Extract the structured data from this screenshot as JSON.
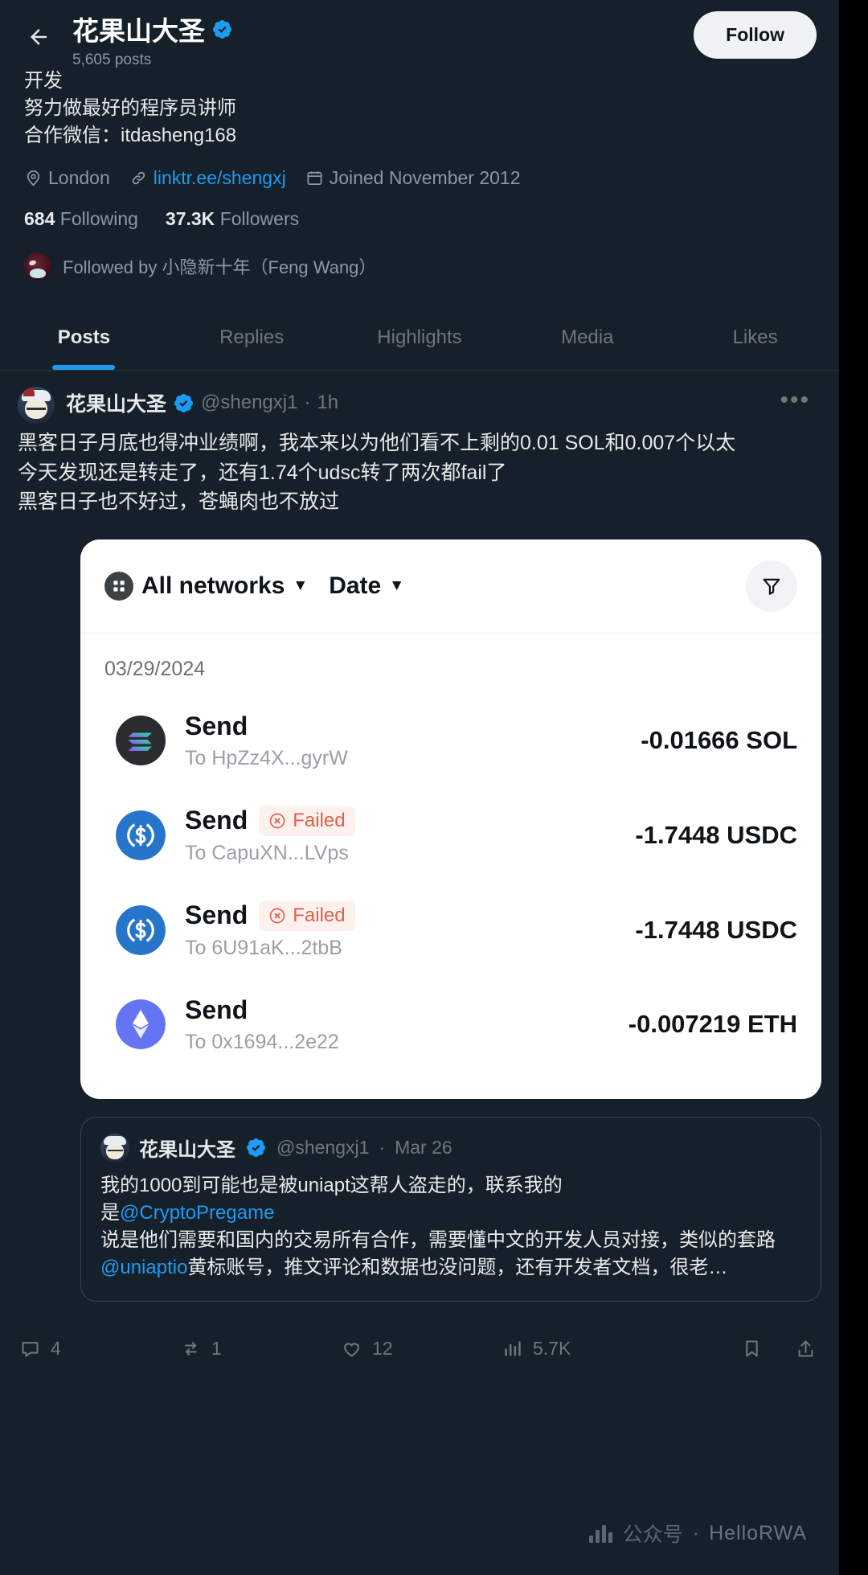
{
  "header": {
    "back_icon": "arrow-left-icon",
    "display_name": "花果山大圣",
    "verified_icon": "verified-badge-icon",
    "posts_count": "5,605 posts",
    "follow_label": "Follow"
  },
  "profile": {
    "bio_lines": [
      "开发",
      "努力做最好的程序员讲师",
      "合作微信：itdasheng168"
    ],
    "location": "London",
    "location_icon": "location-pin-icon",
    "website": "linktr.ee/shengxj",
    "link_icon": "link-icon",
    "joined": "Joined November 2012",
    "calendar_icon": "calendar-icon",
    "following_count": "684",
    "following_label": "Following",
    "followers_count": "37.3K",
    "followers_label": "Followers",
    "followed_by": "Followed by 小隐新十年（Feng Wang）"
  },
  "tabs": [
    {
      "label": "Posts",
      "active": true
    },
    {
      "label": "Replies",
      "active": false
    },
    {
      "label": "Highlights",
      "active": false
    },
    {
      "label": "Media",
      "active": false
    },
    {
      "label": "Likes",
      "active": false
    }
  ],
  "tweet": {
    "author_name": "花果山大圣",
    "author_handle": "@shengxj1",
    "separator": "·",
    "time": "1h",
    "more_icon": "more-horizontal-icon",
    "body_lines": [
      "黑客日子月底也得冲业绩啊，我本来以为他们看不上剩的0.01 SOL和0.007个以太",
      "今天发现还是转走了，还有1.74个udsc转了两次都fail了",
      "黑客日子也不好过，苍蝇肉也不放过"
    ]
  },
  "wallet_card": {
    "network_filter": "All networks",
    "network_icon": "grid-icon",
    "sort_filter": "Date",
    "caret_icon": "caret-down-icon",
    "filter_icon": "filter-funnel-icon",
    "date_group": "03/29/2024",
    "transactions": [
      {
        "token_icon": "solana-icon",
        "title": "Send",
        "status": "",
        "status_icon": "",
        "to": "To HpZz4X...gyrW",
        "amount": "-0.01666 SOL"
      },
      {
        "token_icon": "usdc-icon",
        "title": "Send",
        "status": "Failed",
        "status_icon": "error-circle-icon",
        "to": "To CapuXN...LVps",
        "amount": "-1.7448 USDC"
      },
      {
        "token_icon": "usdc-icon",
        "title": "Send",
        "status": "Failed",
        "status_icon": "error-circle-icon",
        "to": "To 6U91aK...2tbB",
        "amount": "-1.7448 USDC"
      },
      {
        "token_icon": "ethereum-icon",
        "title": "Send",
        "status": "",
        "status_icon": "",
        "to": "To 0x1694...2e22",
        "amount": "-0.007219 ETH"
      }
    ]
  },
  "quoted_tweet": {
    "author_name": "花果山大圣",
    "author_handle": "@shengxj1",
    "separator": "·",
    "time": "Mar 26",
    "line1": "我的1000到可能也是被uniapt这帮人盗走的，联系我的",
    "line2_prefix": "是",
    "line2_mention": "@CryptoPregame",
    "line3": "说是他们需要和国内的交易所有合作，需要懂中文的开发人员对接，类似的套路",
    "line4_mention": "@uniaptio",
    "line4_rest": "黄标账号，推文评论和数据也没问题，还有开发者文档，很老…"
  },
  "actions": {
    "reply_icon": "reply-icon",
    "reply_count": "4",
    "retweet_icon": "retweet-icon",
    "retweet_count": "1",
    "like_icon": "heart-icon",
    "like_count": "12",
    "views_icon": "views-bar-icon",
    "views_count": "5.7K",
    "bookmark_icon": "bookmark-icon",
    "share_icon": "share-upload-icon"
  },
  "watermark": {
    "label": "公众号",
    "separator": "·",
    "brand": "HelloRWA"
  },
  "colors": {
    "background": "#15202b",
    "accent": "#1d9bf0",
    "text": "#e7e9ea",
    "muted": "#71767b",
    "card": "#ffffff",
    "failed": "#e0604b"
  }
}
